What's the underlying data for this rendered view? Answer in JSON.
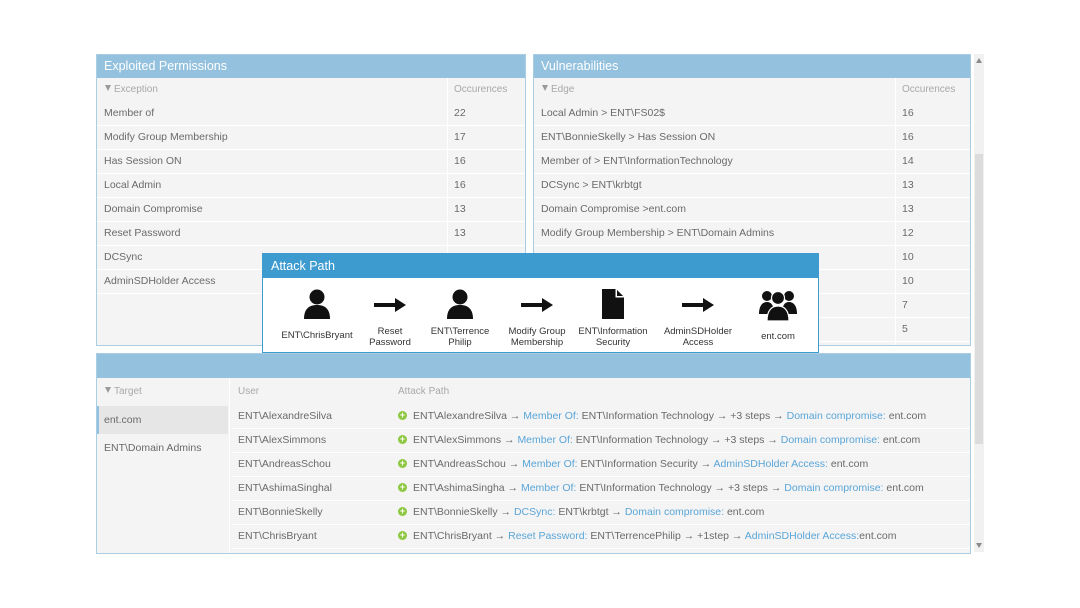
{
  "exploited": {
    "title": "Exploited Permissions",
    "col1": "Exception",
    "col2": "Occurences",
    "rows": [
      {
        "name": "Member of",
        "count": "22"
      },
      {
        "name": "Modify Group Membership",
        "count": "17"
      },
      {
        "name": "Has Session ON",
        "count": "16"
      },
      {
        "name": "Local Admin",
        "count": "16"
      },
      {
        "name": "Domain Compromise",
        "count": "13"
      },
      {
        "name": "Reset Password",
        "count": "13"
      },
      {
        "name": "DCSync",
        "count": ""
      },
      {
        "name": "AdminSDHolder Access",
        "count": ""
      }
    ]
  },
  "vulnerabilities": {
    "title": "Vulnerabilities",
    "col1": "Edge",
    "col2": "Occurences",
    "rows": [
      {
        "name": "Local Admin > ENT\\FS02$",
        "count": "16"
      },
      {
        "name": "ENT\\BonnieSkelly > Has Session ON",
        "count": "16"
      },
      {
        "name": "Member of > ENT\\InformationTechnology",
        "count": "14"
      },
      {
        "name": "DCSync > ENT\\krbtgt",
        "count": "13"
      },
      {
        "name": "Domain Compromise >ent.com",
        "count": "13"
      },
      {
        "name": "Modify Group Membership > ENT\\Domain Admins",
        "count": "12"
      },
      {
        "name": "",
        "count": "10"
      },
      {
        "name": "",
        "count": "10"
      },
      {
        "name": "",
        "count": "7"
      },
      {
        "name": "",
        "count": "5"
      }
    ]
  },
  "attack_path_modal": {
    "title": "Attack Path",
    "steps": [
      {
        "type": "user",
        "label": "ENT\\ChrisBryant"
      },
      {
        "type": "arrow",
        "label": "Reset\nPassword"
      },
      {
        "type": "user",
        "label": "ENT\\Terrence\nPhilip"
      },
      {
        "type": "arrow",
        "label": "Modify Group\nMembership"
      },
      {
        "type": "document",
        "label": "ENT\\Information\nSecurity"
      },
      {
        "type": "arrow",
        "label": "AdminSDHolder\nAccess"
      },
      {
        "type": "group",
        "label": "ent.com"
      }
    ]
  },
  "paths": {
    "col_target": "Target",
    "col_user": "User",
    "col_path": "Attack Path",
    "targets": [
      "ent.com",
      "ENT\\Domain Admins"
    ],
    "rows": [
      {
        "user": "ENT\\AlexandreSilva",
        "segs": [
          [
            "t",
            "ENT\\AlexandreSilva → "
          ],
          [
            "l",
            "Member Of:"
          ],
          [
            "t",
            " ENT\\Information Technology → +3 steps → "
          ],
          [
            "l",
            "Domain compromise:"
          ],
          [
            "t",
            " ent.com"
          ]
        ]
      },
      {
        "user": "ENT\\AlexSimmons",
        "segs": [
          [
            "t",
            "ENT\\AlexSimmons → "
          ],
          [
            "l",
            "Member Of:"
          ],
          [
            "t",
            " ENT\\Information Technology → +3 steps → "
          ],
          [
            "l",
            "Domain compromise:"
          ],
          [
            "t",
            " ent.com"
          ]
        ]
      },
      {
        "user": "ENT\\AndreasSchou",
        "segs": [
          [
            "t",
            "ENT\\AndreasSchou → "
          ],
          [
            "l",
            "Member Of:"
          ],
          [
            "t",
            " ENT\\Information Security → "
          ],
          [
            "l",
            "AdminSDHolder Access:"
          ],
          [
            "t",
            " ent.com"
          ]
        ]
      },
      {
        "user": "ENT\\AshimaSinghal",
        "segs": [
          [
            "t",
            "ENT\\AshimaSingha → "
          ],
          [
            "l",
            "Member Of:"
          ],
          [
            "t",
            " ENT\\Information Technology → +3 steps → "
          ],
          [
            "l",
            "Domain compromise:"
          ],
          [
            "t",
            " ent.com"
          ]
        ]
      },
      {
        "user": "ENT\\BonnieSkelly",
        "segs": [
          [
            "t",
            "ENT\\BonnieSkelly → "
          ],
          [
            "l",
            "DCSync:"
          ],
          [
            "t",
            " ENT\\krbtgt → "
          ],
          [
            "l",
            "Domain compromise:"
          ],
          [
            "t",
            " ent.com"
          ]
        ]
      },
      {
        "user": "ENT\\ChrisBryant",
        "segs": [
          [
            "t",
            "ENT\\ChrisBryant → "
          ],
          [
            "l",
            "Reset Password:"
          ],
          [
            "t",
            " ENT\\TerrencePhilip → +1step → "
          ],
          [
            "l",
            "AdminSDHolder Access:"
          ],
          [
            "t",
            "ent.com"
          ]
        ]
      }
    ]
  },
  "colors": {
    "panel_header": "#94c2de",
    "modal_header": "#3d9bd0",
    "link": "#5aa5d8",
    "plus_icon": "#8dc63f"
  }
}
